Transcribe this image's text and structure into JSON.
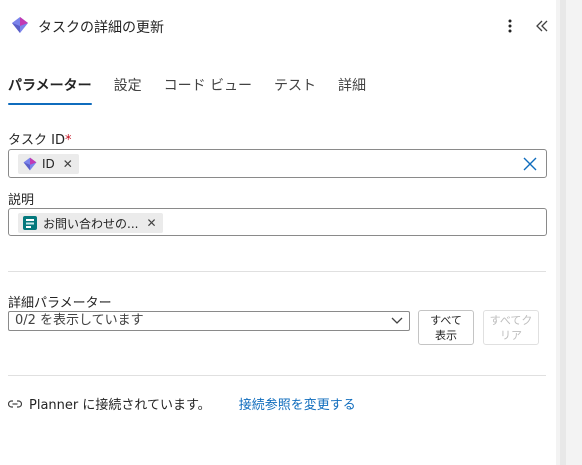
{
  "header": {
    "title": "タスクの詳細の更新",
    "more_icon": "more-vertical-icon",
    "collapse_icon": "double-chevron-left-icon",
    "logo_icon": "planner-logo-icon"
  },
  "tabs": [
    {
      "label": "パラメーター",
      "active": true
    },
    {
      "label": "設定",
      "active": false
    },
    {
      "label": "コード ビュー",
      "active": false
    },
    {
      "label": "テスト",
      "active": false
    },
    {
      "label": "詳細",
      "active": false
    }
  ],
  "task_id": {
    "label": "タスク ID",
    "required_mark": "*",
    "token_label": "ID",
    "token_remove": "✕",
    "clear_icon": "close-icon"
  },
  "description": {
    "label": "説明",
    "token_label": "お問い合わせの...",
    "token_remove": "✕",
    "token_icon": "forms-icon"
  },
  "advanced": {
    "label": "詳細パラメーター",
    "select_value": "0/2 を表示しています",
    "show_all_line1": "すべて",
    "show_all_line2": "表示",
    "clear_all_line1": "すべてク",
    "clear_all_line2": "リア"
  },
  "connection": {
    "status_text": "Planner に接続されています。",
    "change_link": "接続参照を変更する",
    "icon": "link-icon"
  },
  "colors": {
    "accent": "#0f6cbd",
    "required": "#c50f1f"
  }
}
